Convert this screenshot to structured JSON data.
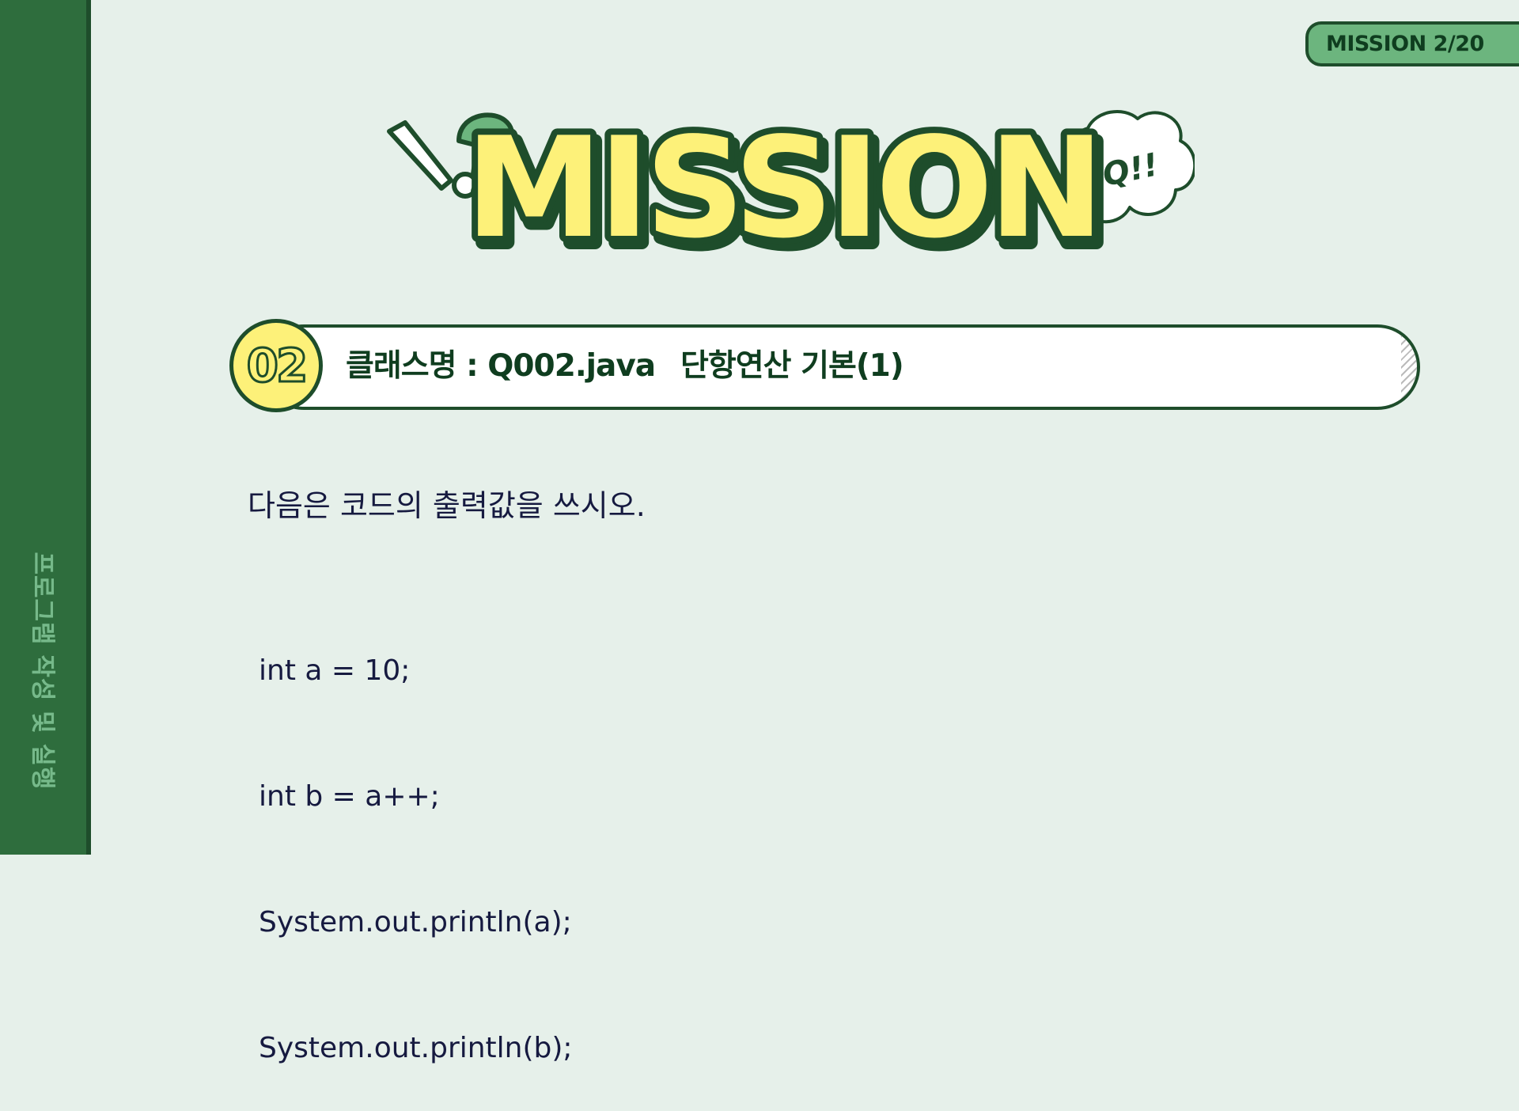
{
  "sidebar": {
    "label": "프로그램 작성 및 실행"
  },
  "badge": {
    "text": "MISSION 2/20"
  },
  "banner": {
    "title": "MISSION",
    "bubble_text": "Q!!",
    "icons": [
      "exclamation-icon",
      "question-icon",
      "speech-bubble-icon"
    ],
    "colors": {
      "title_fill": "#fdf179",
      "outline": "#1e4d2b",
      "accent": "#6cb57e"
    }
  },
  "mission_header": {
    "number": "02",
    "class_label": "클래스명 : Q002.java",
    "topic": "단항연산 기본(1)"
  },
  "question": {
    "prompt": "다음은 코드의 출력값을 쓰시오.",
    "code_lines": [
      "int a = 10;",
      "int b = a++;",
      "System.out.println(a);",
      "System.out.println(b);"
    ]
  }
}
